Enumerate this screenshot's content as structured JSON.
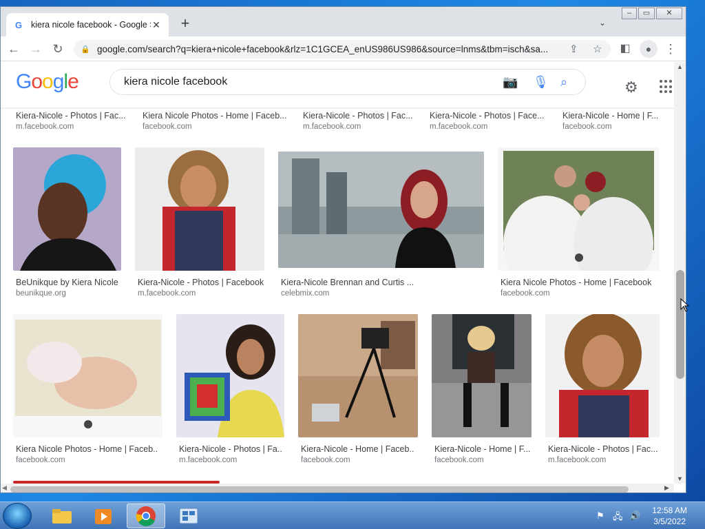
{
  "window": {
    "tab_title": "kiera nicole facebook - Google S",
    "tab_favicon": "G",
    "url": "google.com/search?q=kiera+nicole+facebook&rlz=1C1GCEA_enUS986US986&source=lnms&tbm=isch&sa..."
  },
  "google": {
    "logo": "Google",
    "query": "kiera nicole facebook",
    "colors": {
      "blue": "#4285f4",
      "red": "#ea4335",
      "yellow": "#fbbc05",
      "green": "#34a853"
    }
  },
  "results": {
    "top_row": [
      {
        "title": "Kiera-Nicole - Photos | Fac...",
        "source": "m.facebook.com"
      },
      {
        "title": "Kiera Nicole Photos - Home | Faceb...",
        "source": "facebook.com"
      },
      {
        "title": "Kiera-Nicole - Photos | Fac...",
        "source": "m.facebook.com"
      },
      {
        "title": "Kiera-Nicole - Photos | Face...",
        "source": "m.facebook.com"
      },
      {
        "title": "Kiera-Nicole - Home | F...",
        "source": "facebook.com"
      }
    ],
    "row2": [
      {
        "title": "BeUnikque by Kiera Nicole",
        "source": "beunikque.org"
      },
      {
        "title": "Kiera-Nicole - Photos | Facebook",
        "source": "m.facebook.com"
      },
      {
        "title": "Kiera-Nicole Brennan and Curtis ...",
        "source": "celebmix.com"
      },
      {
        "title": "Kiera Nicole Photos - Home | Facebook",
        "source": "facebook.com"
      }
    ],
    "row3": [
      {
        "title": "Kiera Nicole Photos - Home | Faceb...",
        "source": "facebook.com"
      },
      {
        "title": "Kiera-Nicole - Photos | Fa...",
        "source": "m.facebook.com"
      },
      {
        "title": "Kiera-Nicole - Home | Faceb...",
        "source": "facebook.com"
      },
      {
        "title": "Kiera-Nicole - Home | F...",
        "source": "facebook.com"
      },
      {
        "title": "Kiera-Nicole - Photos | Fac...",
        "source": "m.facebook.com"
      }
    ]
  },
  "taskbar": {
    "time": "12:58 AM",
    "date": "3/5/2022"
  }
}
